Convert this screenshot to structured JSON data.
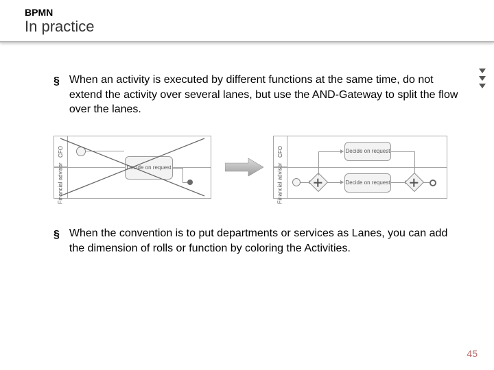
{
  "header": {
    "small": "BPMN",
    "large": "In practice"
  },
  "bullets": [
    "When an activity is executed by different functions at the same time, do not extend the activity over several lanes, but use the AND-Gateway to split the flow over the lanes.",
    "When the convention is to put departments or services as Lanes, you can add the dimension of rolls or function by coloring the Activities."
  ],
  "diagram": {
    "left": {
      "lane1": "CFO",
      "lane2": "Financial advisor",
      "task": "Decide on request"
    },
    "right": {
      "lane1": "CFO",
      "lane2": "Financial advisor",
      "task_top": "Decide on request",
      "task_bot": "Decide on request"
    }
  },
  "page_number": "45"
}
